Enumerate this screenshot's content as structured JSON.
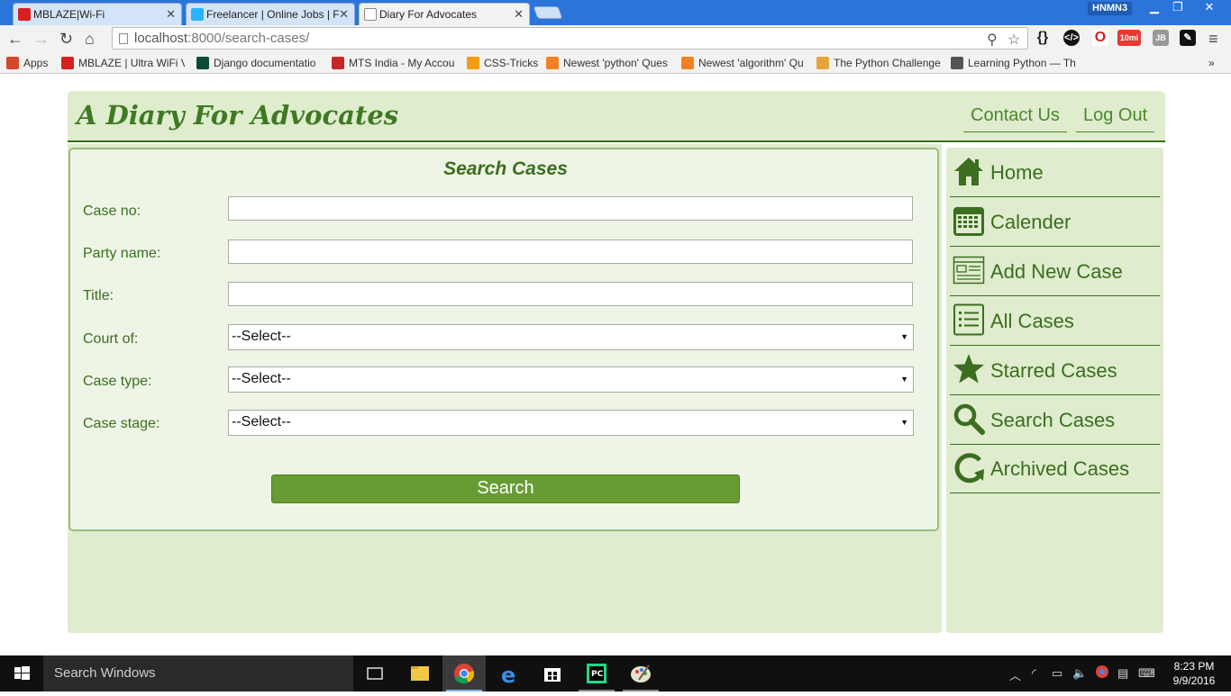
{
  "browser": {
    "tabs": [
      {
        "title": "MBLAZE|Wi-Fi",
        "fav_color": "#d6211f"
      },
      {
        "title": "Freelancer | Online Jobs | F",
        "fav_color": "#29b2fe"
      },
      {
        "title": "Diary For Advocates",
        "fav_color": "#ffffff"
      }
    ],
    "profile": "HNMN3",
    "url_host": "localhost",
    "url_path": ":8000/search-cases/",
    "bookmarks": [
      {
        "label": "Apps",
        "color": "#d6482d"
      },
      {
        "label": "MBLAZE | Ultra WiFi V",
        "color": "#d6211f"
      },
      {
        "label": "Django documentatio",
        "color": "#0c4b33"
      },
      {
        "label": "MTS India - My Accou",
        "color": "#c62828"
      },
      {
        "label": "CSS-Tricks",
        "color": "#f39c12"
      },
      {
        "label": "Newest 'python' Ques",
        "color": "#f48024"
      },
      {
        "label": "Newest 'algorithm' Qu",
        "color": "#f48024"
      },
      {
        "label": "The Python Challenge",
        "color": "#e8a33b"
      },
      {
        "label": "Learning Python — Th",
        "color": "#555555"
      }
    ],
    "ext_badge": "10mi",
    "ext_jb": "JB"
  },
  "header": {
    "site_title": "A Diary For Advocates",
    "contact": "Contact Us",
    "logout": "Log Out"
  },
  "form": {
    "title": "Search Cases",
    "case_no_label": "Case no:",
    "party_label": "Party name:",
    "title_label": "Title:",
    "court_label": "Court of:",
    "court_value": "--Select--",
    "type_label": "Case type:",
    "type_value": "--Select--",
    "stage_label": "Case stage:",
    "stage_value": "--Select--",
    "button": "Search"
  },
  "sidebar": {
    "items": [
      {
        "label": "Home",
        "icon": "home-icon"
      },
      {
        "label": "Calender",
        "icon": "calendar-icon"
      },
      {
        "label": "Add New Case",
        "icon": "add-case-icon"
      },
      {
        "label": "All Cases",
        "icon": "list-icon"
      },
      {
        "label": "Starred Cases",
        "icon": "star-icon"
      },
      {
        "label": "Search Cases",
        "icon": "search-icon"
      },
      {
        "label": "Archived Cases",
        "icon": "archive-icon"
      }
    ]
  },
  "taskbar": {
    "search_placeholder": "Search Windows",
    "time": "8:23 PM",
    "date": "9/9/2016"
  },
  "colors": {
    "brand_green": "#3b6e1f",
    "panel_bg": "#dfecce",
    "button_green": "#679c34"
  }
}
